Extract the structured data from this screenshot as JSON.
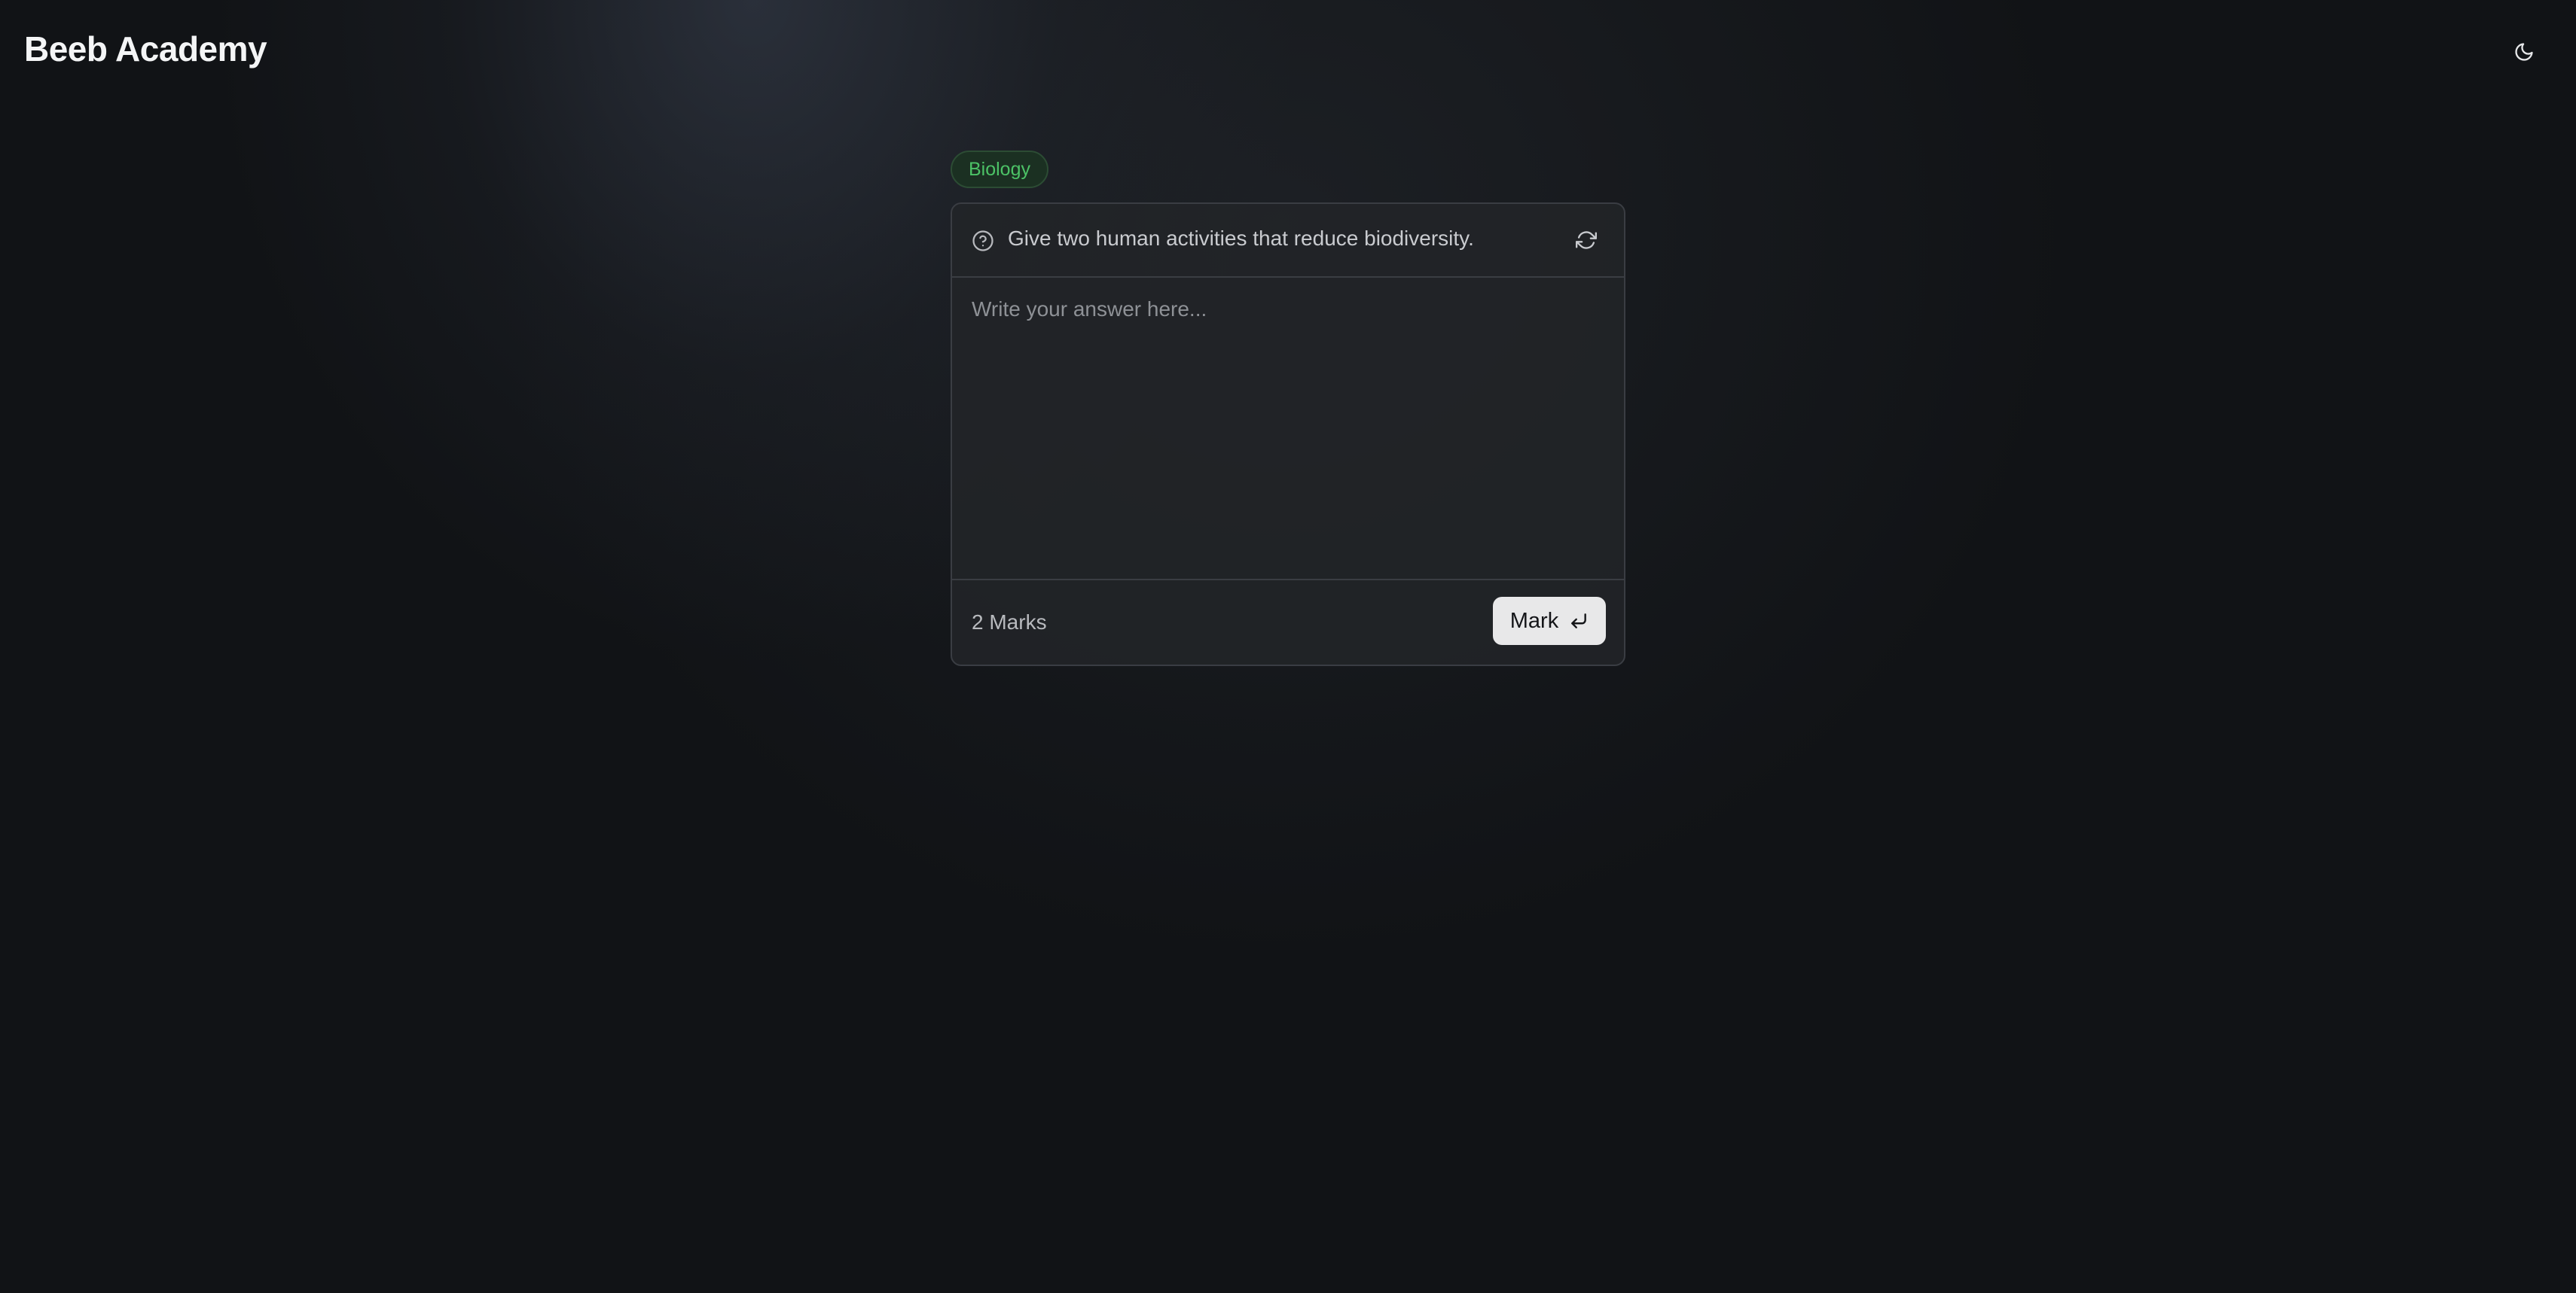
{
  "header": {
    "brand": "Beeb Academy",
    "theme_toggle_icon": "moon-icon"
  },
  "question_card": {
    "subject": "Biology",
    "subject_color": "#4cc266",
    "question_icon": "question-circle-icon",
    "question": "Give two human activities that reduce biodiversity.",
    "refresh_icon": "refresh-icon",
    "answer_placeholder": "Write your answer here...",
    "answer_value": "",
    "marks": "2 Marks",
    "submit_label": "Mark",
    "submit_icon": "enter-icon"
  }
}
